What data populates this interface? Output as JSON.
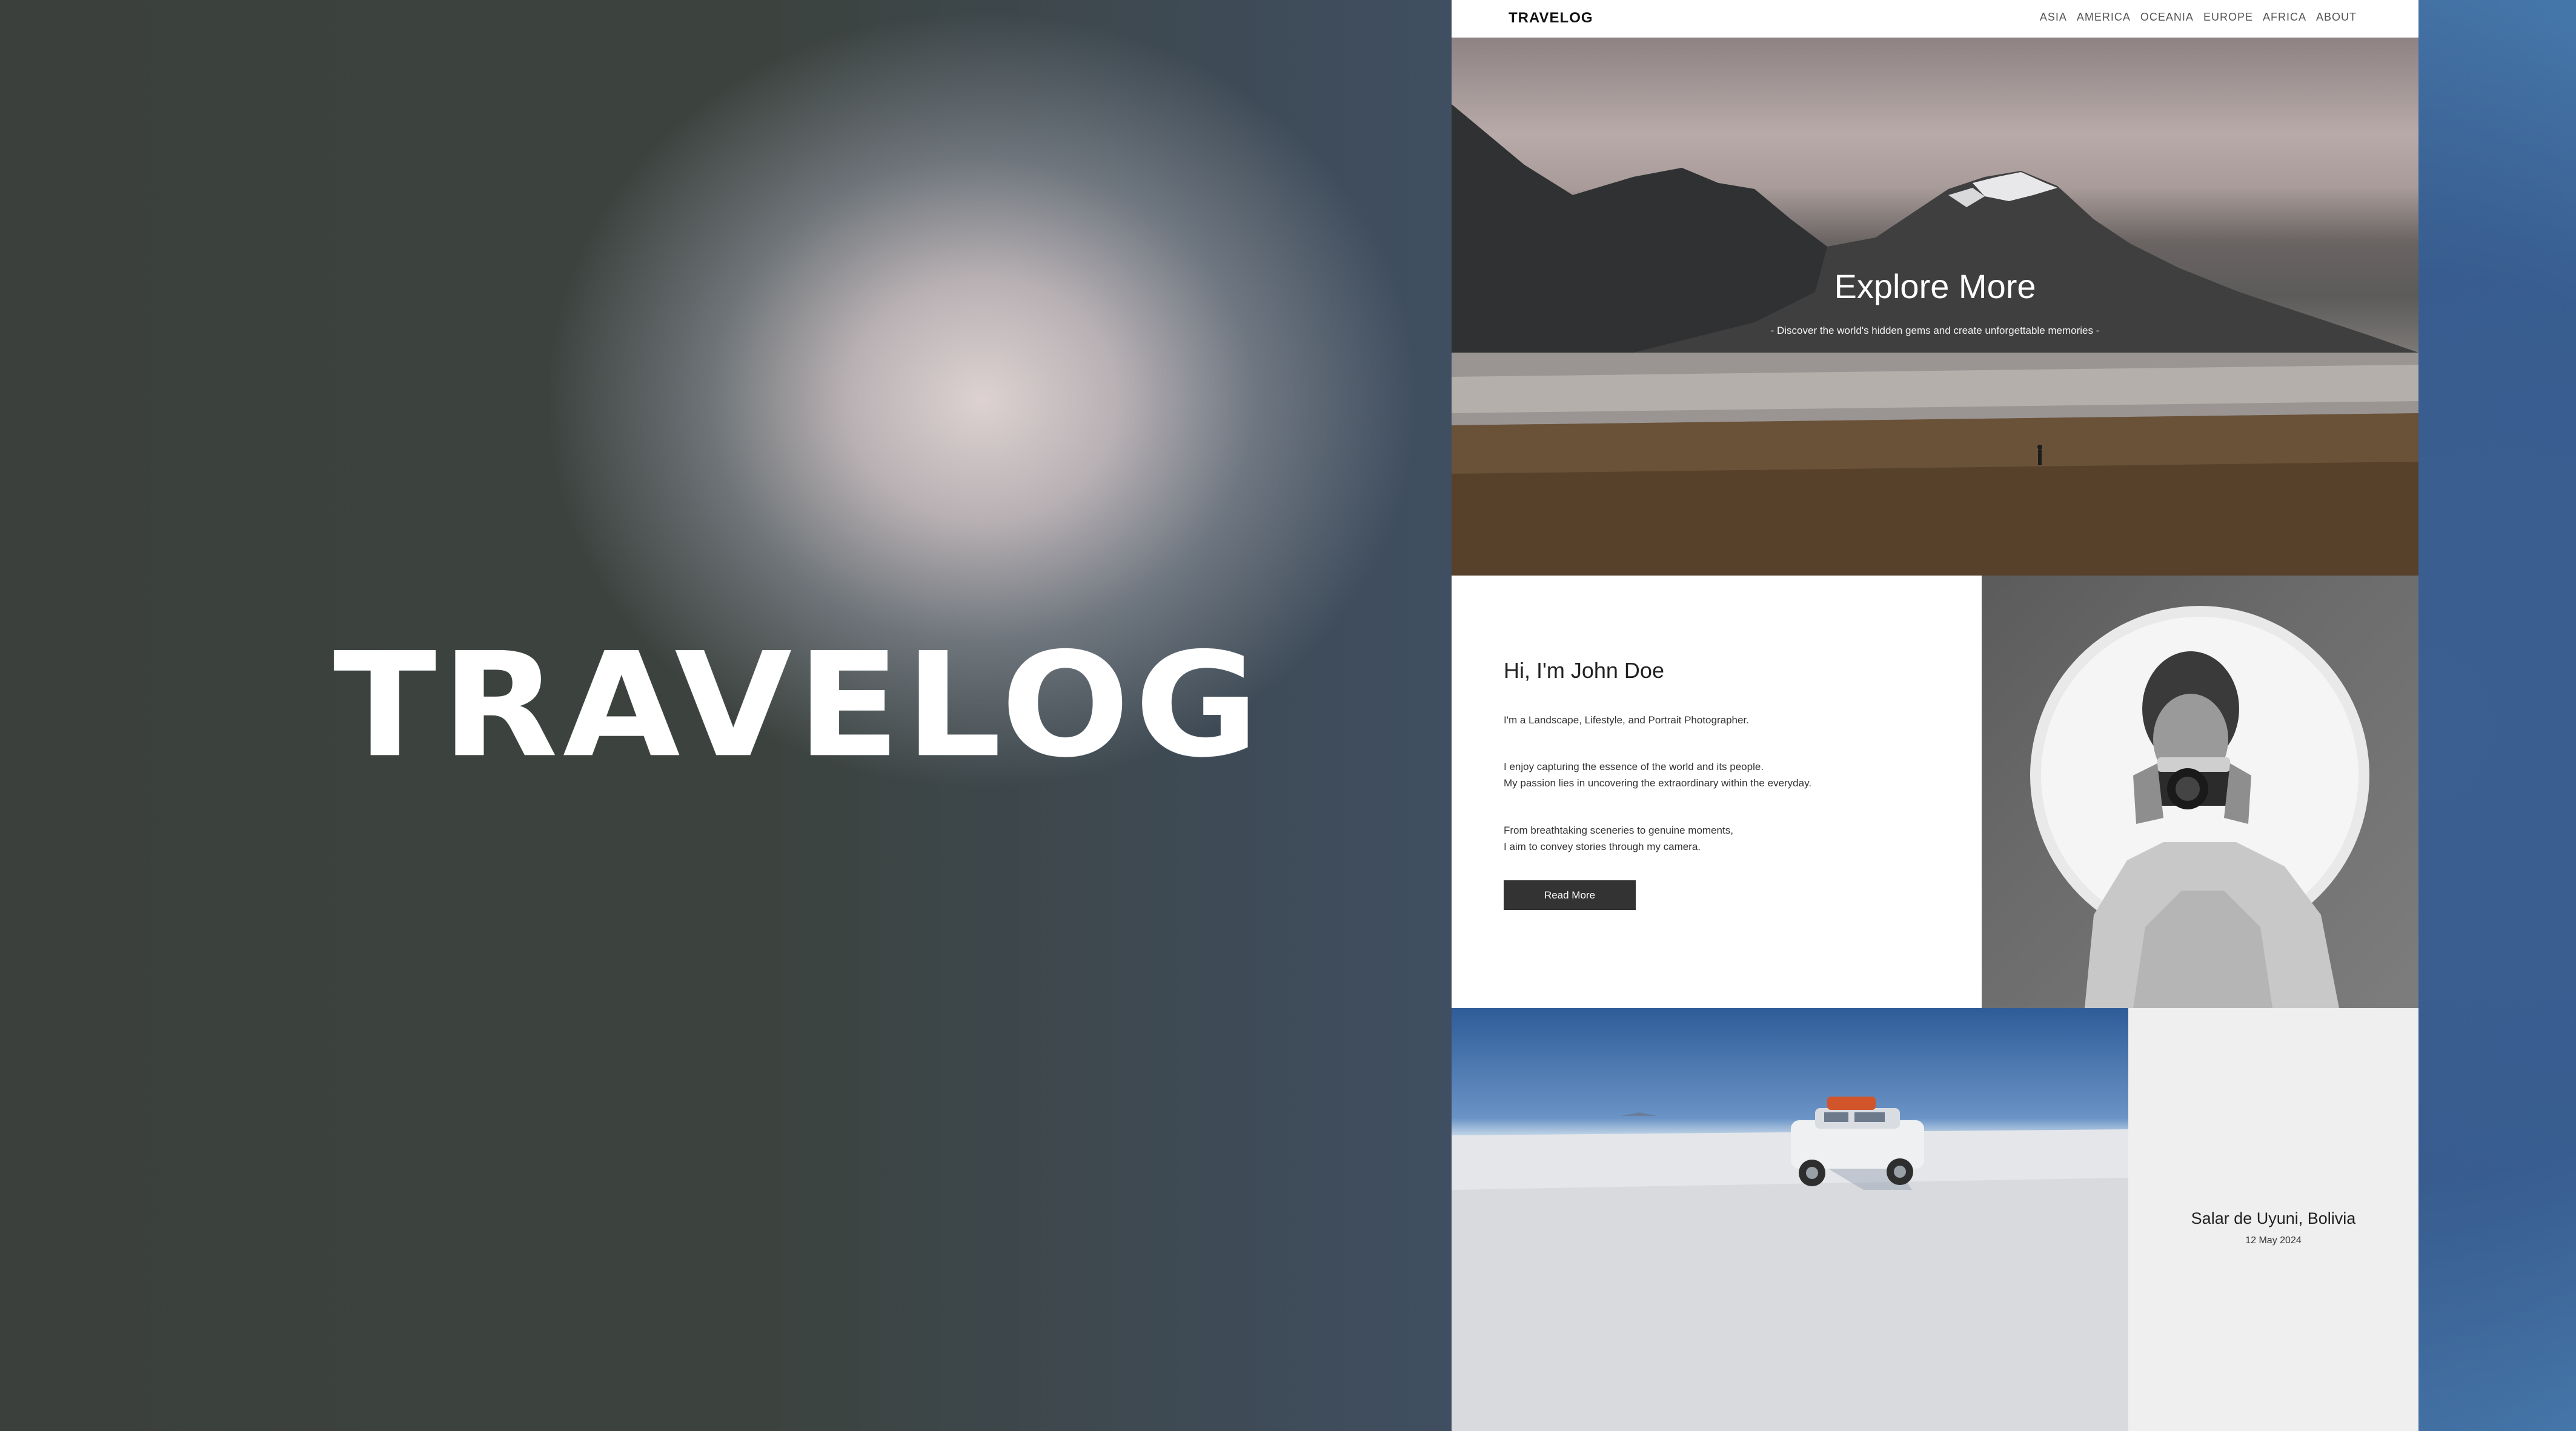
{
  "showcase": {
    "headline": "TRAVELOG"
  },
  "nav": {
    "brand": "TRAVELOG",
    "items": [
      "ASIA",
      "AMERICA",
      "OCEANIA",
      "EUROPE",
      "AFRICA",
      "ABOUT"
    ]
  },
  "hero": {
    "title": "Explore More",
    "subtitle": "- Discover the world's hidden gems and create unforgettable memories -"
  },
  "about": {
    "heading": "Hi, I'm John Doe",
    "intro": "I'm a Landscape, Lifestyle, and Portrait Photographer.",
    "passion_line1": "I enjoy capturing the essence of the world and its people.",
    "passion_line2": "My passion lies in uncovering the extraordinary within the everyday.",
    "story_line1": "From breathtaking sceneries to genuine moments,",
    "story_line2": "I aim to convey stories through my camera.",
    "button_label": "Read More"
  },
  "featured": {
    "place": "Salar de Uyuni, Bolivia",
    "date": "12 May 2024"
  },
  "colors": {
    "button": "#333333",
    "caption_panel": "#efefef",
    "accent_blue": "#3d6394"
  }
}
